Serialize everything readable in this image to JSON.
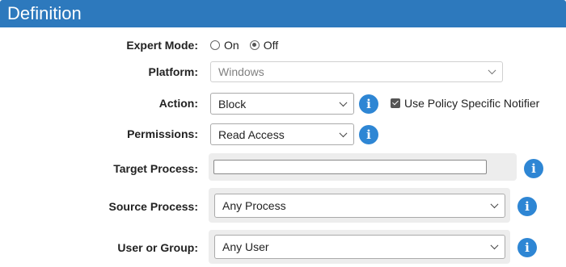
{
  "header": {
    "title": "Definition"
  },
  "form": {
    "expert_mode": {
      "label": "Expert Mode:",
      "options": [
        "On",
        "Off"
      ],
      "selected": "Off"
    },
    "platform": {
      "label": "Platform:",
      "value": "Windows",
      "disabled": true
    },
    "action": {
      "label": "Action:",
      "value": "Block"
    },
    "use_policy_notifier": {
      "label": "Use Policy Specific Notifier",
      "checked": true
    },
    "permissions": {
      "label": "Permissions:",
      "value": "Read Access"
    },
    "target_process": {
      "label": "Target Process:",
      "value": ""
    },
    "source_process": {
      "label": "Source Process:",
      "value": "Any Process"
    },
    "user_or_group": {
      "label": "User or Group:",
      "value": "Any User"
    }
  },
  "icons": {
    "info": "i",
    "info_name": "info-icon"
  },
  "colors": {
    "header_bg": "#2d79bd",
    "info_bg": "#2e86d4",
    "panel_bg": "#ededed"
  }
}
